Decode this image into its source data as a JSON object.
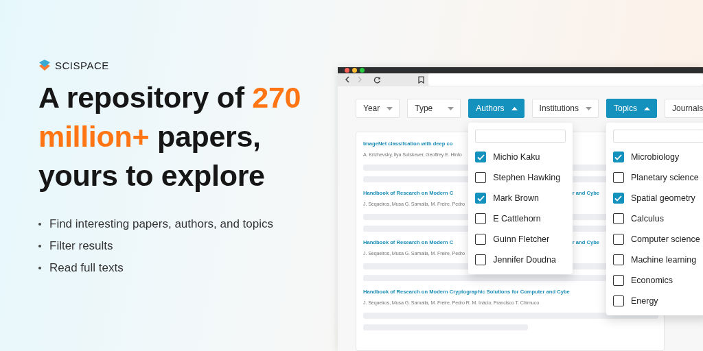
{
  "brand": {
    "name": "SCISPACE"
  },
  "headline": [
    {
      "text": "A repository of ",
      "highlight": false
    },
    {
      "text": "270 million+",
      "highlight": true
    },
    {
      "text": " papers, yours to explore",
      "highlight": false
    }
  ],
  "bullets": [
    "Find interesting papers, authors, and topics",
    "Filter results",
    "Read full texts"
  ],
  "browser": {
    "filters": [
      {
        "label": "Year",
        "open": false
      },
      {
        "label": "Type",
        "open": false
      },
      {
        "label": "Authors",
        "open": true,
        "options": [
          {
            "label": "Michio Kaku",
            "checked": true
          },
          {
            "label": "Stephen Hawking",
            "checked": false
          },
          {
            "label": "Mark Brown",
            "checked": true
          },
          {
            "label": "E Cattlehorn",
            "checked": false
          },
          {
            "label": "Guinn Fletcher",
            "checked": false
          },
          {
            "label": "Jennifer Doudna",
            "checked": false
          }
        ]
      },
      {
        "label": "Institutions",
        "open": false
      },
      {
        "label": "Topics",
        "open": true,
        "options": [
          {
            "label": "Microbiology",
            "checked": true
          },
          {
            "label": "Planetary science",
            "checked": false
          },
          {
            "label": "Spatial geometry",
            "checked": true
          },
          {
            "label": "Calculus",
            "checked": false
          },
          {
            "label": "Computer science",
            "checked": false
          },
          {
            "label": "Machine learning",
            "checked": false
          },
          {
            "label": "Economics",
            "checked": false
          },
          {
            "label": "Energy",
            "checked": false
          }
        ]
      },
      {
        "label": "Journals",
        "open": false
      }
    ],
    "results": [
      {
        "title": "ImageNet classifcation with deep co",
        "authors": "A. Krizhevsky, Ilya Sutskever, Geoffrey E. Hinto"
      },
      {
        "title": "Handbook of Research on Modern C",
        "title_tail": "r and Cybe",
        "authors": "J. Sequeiros, Musa G. Samaila, M. Freire, Pedro"
      },
      {
        "title": "Handbook of Research on Modern C",
        "title_tail": "r and Cybe",
        "authors": "J. Sequeiros, Musa G. Samaila, M. Freire, Pedro"
      },
      {
        "title": "Handbook of Research on Modern Cryptographic Solutions for Computer and Cybe",
        "authors": "J. Sequeiros, Musa G. Samaila, M. Freire, Pedro R. M. Inácio, Francisco T. Chimuco"
      }
    ]
  }
}
